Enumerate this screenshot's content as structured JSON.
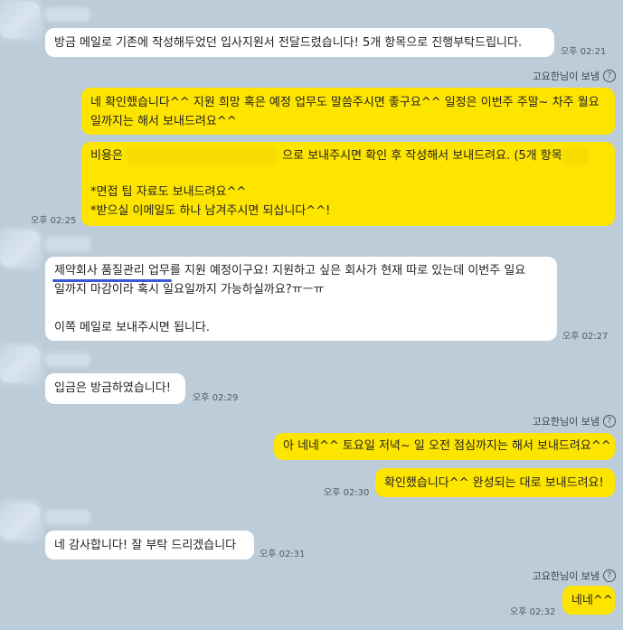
{
  "messages": [
    {
      "id": "m1",
      "dir": "in",
      "text": "방금 메일로 기존에 작성해두었던 입사지원서 전달드렸습니다! 5개 항목으로 진행부탁드립니다.",
      "time": "오후 02:21"
    },
    {
      "id": "m2",
      "dir": "out",
      "sender": "고요한님이 보냄",
      "lines": [
        "네 확인했습니다^^ 지원 희망 혹은 예정 업무도 말씀주시면 좋구요^^ 일정은 이번주 주말~ 차주 월요",
        "일까지는 해서 보내드려요^^"
      ]
    },
    {
      "id": "m3",
      "dir": "out",
      "time": "오후 02:25",
      "line1_prefix": "비용은",
      "line1_suffix": "으로 보내주시면 확인 후 작성해서 보내드려요. (5개 항목",
      "line2": "*면접 팁 자료도 보내드려요^^",
      "line3": "*받으실 이메일도 하나 남겨주시면 되십니다^^!"
    },
    {
      "id": "m4",
      "dir": "in",
      "time": "오후 02:27",
      "highlight": "제약회사 품질관리 업무",
      "line1_rest": "를 지원 예정이구요! 지원하고 싶은 회사가 현재 따로 있는데 이번주 일요",
      "line2": "일까지 마감이라 혹시 일요일까지 가능하실까요?ㅠㅡㅠ",
      "line3": "이쪽 메일로 보내주시면 됩니다."
    },
    {
      "id": "m5",
      "dir": "in",
      "text": "입금은 방금하였습니다!",
      "time": "오후 02:29"
    },
    {
      "id": "m6",
      "dir": "out",
      "sender": "고요한님이 보냄",
      "text": "아 네네^^ 토요일 저녁~ 일 오전 점심까지는 해서 보내드려요^^"
    },
    {
      "id": "m7",
      "dir": "out",
      "text": "확인했습니다^^ 완성되는 대로 보내드려요!",
      "time": "오후 02:30"
    },
    {
      "id": "m8",
      "dir": "in",
      "text": "네 감사합니다! 잘 부탁 드리겠습니다",
      "time": "오후 02:31"
    },
    {
      "id": "m9",
      "dir": "out",
      "sender": "고요한님이 보냄",
      "text": "네네^^",
      "time": "오후 02:32"
    }
  ],
  "icons": {
    "info": "info-icon",
    "avatar": "avatar-blurred"
  },
  "colors": {
    "background": "#bcccd9",
    "outgoing_bubble": "#fee500",
    "incoming_bubble": "#ffffff",
    "highlight_underline": "#3a57d8"
  },
  "info_glyph": "?"
}
